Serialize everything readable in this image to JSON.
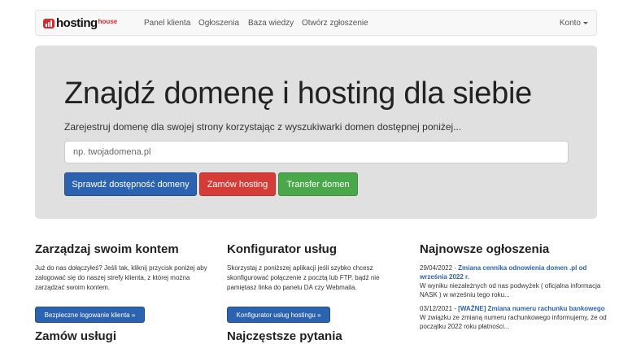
{
  "brand": {
    "name": "hosting",
    "sub": "house",
    "color": "#e3262b"
  },
  "nav": {
    "items": [
      "Panel klienta",
      "Ogłoszenia",
      "Baza wiedzy",
      "Otwórz zgłoszenie"
    ],
    "account": "Konto"
  },
  "hero": {
    "title": "Znajdź domenę i hosting dla siebie",
    "subtitle": "Zarejestruj domenę dla swojej strony korzystając z wyszukiwarki domen dostępnej poniżej...",
    "search_placeholder": "np. twojadomena.pl",
    "buttons": {
      "check": "Sprawdź dostępność domeny",
      "order_hosting": "Zamów hosting",
      "transfer": "Transfer domen"
    }
  },
  "columns": {
    "account": {
      "title": "Zarządzaj swoim kontem",
      "text": "Już do nas dołączyłeś? Jeśli tak, kliknij przycisk poniżej aby zalogować się do naszej strefy klienta, z której można zarządzać swoim kontem.",
      "button": "Bezpieczne logowanie klienta »",
      "next_title": "Zamów usługi"
    },
    "configurator": {
      "title": "Konfigurator usług",
      "text": "Skorzystaj z poniższej aplikacji jeśli szybko chcesz skonfigurować połączenie z pocztą lub FTP, bądź nie pamiętasz linka do panelu DA czy Webmaila.",
      "button": "Konfigurator usług hostingu »",
      "next_title": "Najczęstsze pytania"
    },
    "news": {
      "title": "Najnowsze ogłoszenia",
      "items": [
        {
          "date": "29/04/2022",
          "sep": " - ",
          "link": "Zmiana cennika odnowienia domen .pl od września 2022 r.",
          "body": "W wyniku niezależnych od nas podwyżek ( oficjalna informacja NASK ) w wrześniu tego roku..."
        },
        {
          "date": "03/12/2021",
          "sep": " - ",
          "link": "[WAŻNE] Zmiana numeru rachunku bankowego",
          "body": "W związku ze zmianą numeru rachunkowego informujemy, że od początku 2022 roku płatności..."
        }
      ]
    }
  },
  "colors": {
    "primary": "#2c63b0",
    "danger": "#d63c37",
    "success": "#4aa84a",
    "jumbotron": "#e0e0e0"
  }
}
